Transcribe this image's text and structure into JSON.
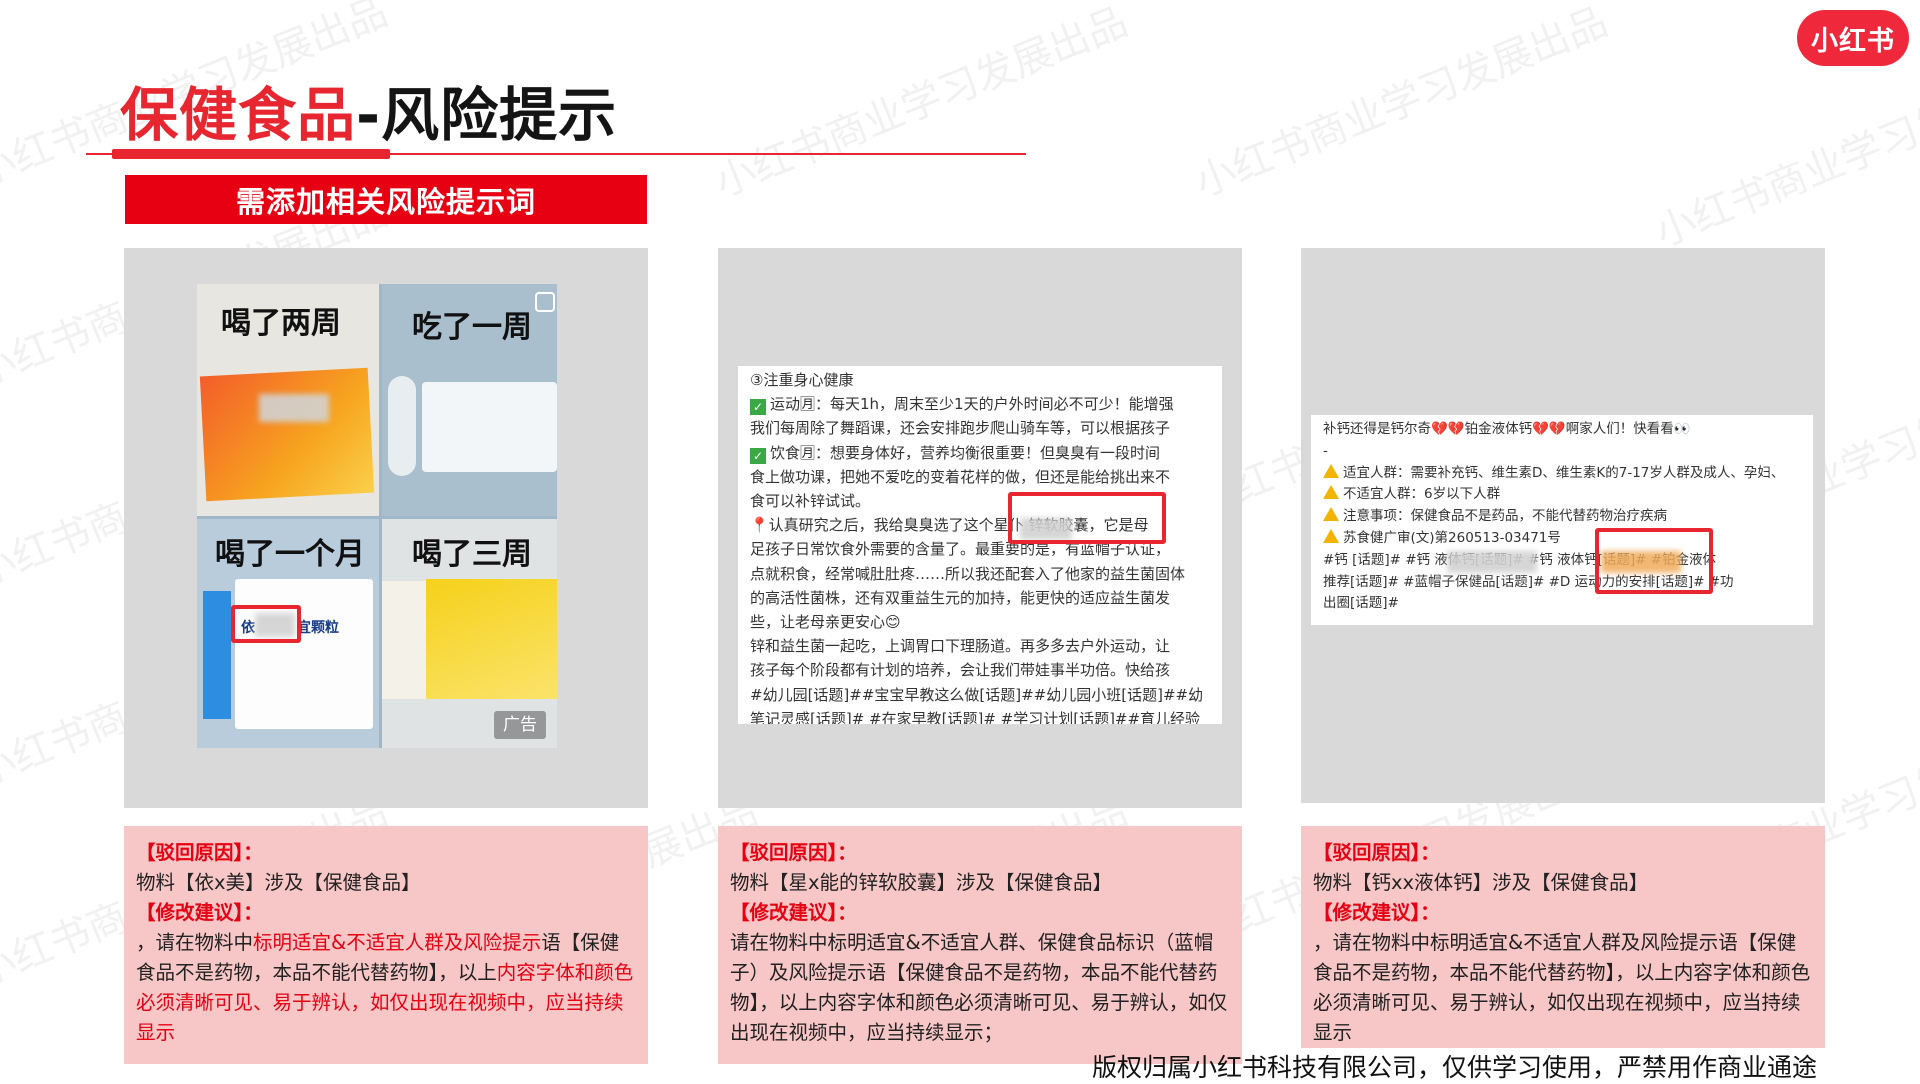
{
  "header": {
    "title_red": "保健食品",
    "title_dark": "-风险提示",
    "logo": "小红书"
  },
  "banner": "需添加相关风险提示词",
  "watermark_text": "小红书商业学习发展出品",
  "panel1": {
    "labels": [
      "喝了两周",
      "吃了一周",
      "喝了一个月",
      "喝了三周"
    ],
    "ad_label": "广告",
    "product_text": "依",
    "product_text2": "宜颗粒",
    "reason": {
      "reject_heading": "【驳回原因】：",
      "reject_text": "物料【依x美】涉及【保健食品】",
      "suggest_heading": "【修改建议】：",
      "suggest_text_1": "，请在物料中",
      "suggest_text_2": "标明适宜&不适宜人群及风险提示",
      "suggest_text_3": "语【保健食品不是药物，本品不能代替药物】，以上",
      "suggest_text_4": "内容字体和颜色必须清晰可见、易于辨认，如仅出现在视频中，应当持续显示"
    }
  },
  "panel2": {
    "lines": [
      "③注重身心健康",
      "运动🈷：每天1h，周末至少1天的户外时间必不可少！能增强",
      "我们每周除了舞蹈课，还会安排跑步爬山骑车等，可以根据孩子",
      "饮食🈷：想要身体好，营养均衡很重要！但臭臭有一段时间",
      "食上做功课，把她不爱吃的变着花样的做，但还是能给挑出来不",
      "食可以补锌试试。",
      "📍认真研究之后，我给臭臭选了这个星仆   锌软胶囊，它是母",
      "足孩子日常饮食外需要的含量了。最重要的是，有蓝帽子认证，",
      "点就积食，经常喊肚肚疼……所以我还配套入了他家的益生菌固体",
      "的高活性菌株，还有双重益生元的加持，能更快的适应益生菌发",
      "些，让老母亲更安心😊",
      "锌和益生菌一起吃，上调胃口下理肠道。再多多去户外运动，让",
      "孩子每个阶段都有计划的培养，会让我们带娃事半功倍。快给孩",
      "#幼儿园[话题]##宝宝早教这么做[话题]##幼儿园小班[话题]##幼",
      "笔记灵感[话题]# #在家早教[话题]# #学习计划[话题]##育儿经验"
    ],
    "reason": {
      "reject_heading": "【驳回原因】：",
      "reject_text": "物料【星x能的锌软胶囊】涉及【保健食品】",
      "suggest_heading": "【修改建议】：",
      "suggest_text": "请在物料中标明适宜&不适宜人群、保健食品标识（蓝帽子）及风险提示语【保健食品不是药物，本品不能代替药物】，以上内容字体和颜色必须清晰可见、易于辨认，如仅出现在视频中，应当持续显示；"
    }
  },
  "panel3": {
    "lines": [
      "补钙还得是钙尔奇💔💔铂金液体钙💔💔啊家人们！快看看👀",
      "-",
      "适宜人群：需要补充钙、维生素D、维生素K的7-17岁人群及成人、孕妇、",
      "不适宜人群：6岁以下人群",
      "注意事项：保健食品不是药品，不能代替药物治疗疾病",
      "苏食健广审(文)第260513-03471号",
      "#钙 [话题]# #钙      液体钙[话题]# #钙   液体钙[话题]# #铂金液体",
      "推荐[话题]# #蓝帽子保健品[话题]# #D    运动力的安排[话题]# #功",
      "出圈[话题]#"
    ],
    "reason": {
      "reject_heading": "【驳回原因】：",
      "reject_text": "物料【钙xx液体钙】涉及【保健食品】",
      "suggest_heading": "【修改建议】：",
      "suggest_text": "，请在物料中标明适宜&不适宜人群及风险提示语【保健食品不是药物，本品不能代替药物】，以上内容字体和颜色必须清晰可见、易于辨认，如仅出现在视频中，应当持续显示"
    }
  },
  "footer": "版权归属小红书科技有限公司，仅供学习使用，严禁用作商业通途"
}
